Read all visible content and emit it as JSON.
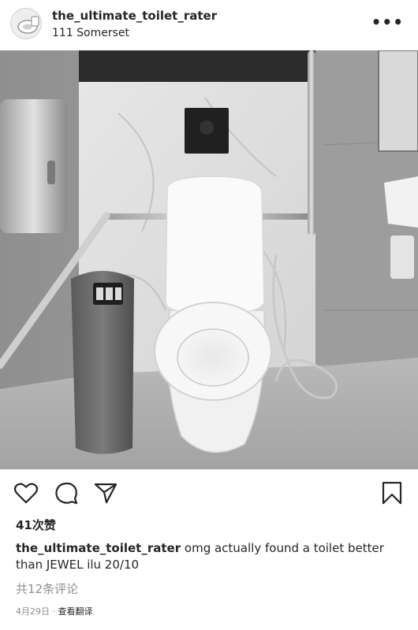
{
  "post": {
    "username": "the_ultimate_toilet_rater",
    "location": "111 Somerset",
    "more_icon": "more-horizontal-icon",
    "more_label": "•••",
    "likes": "41次赞",
    "caption_text": "omg actually found a toilet better than JEWEL ilu 20/10",
    "comments_link": "共12条评论",
    "date": "4月29日",
    "separator": " · ",
    "translate": "查看翻译"
  },
  "icons": {
    "like": "heart-icon",
    "comment": "comment-bubble-icon",
    "share": "paper-plane-icon",
    "save": "bookmark-icon"
  }
}
